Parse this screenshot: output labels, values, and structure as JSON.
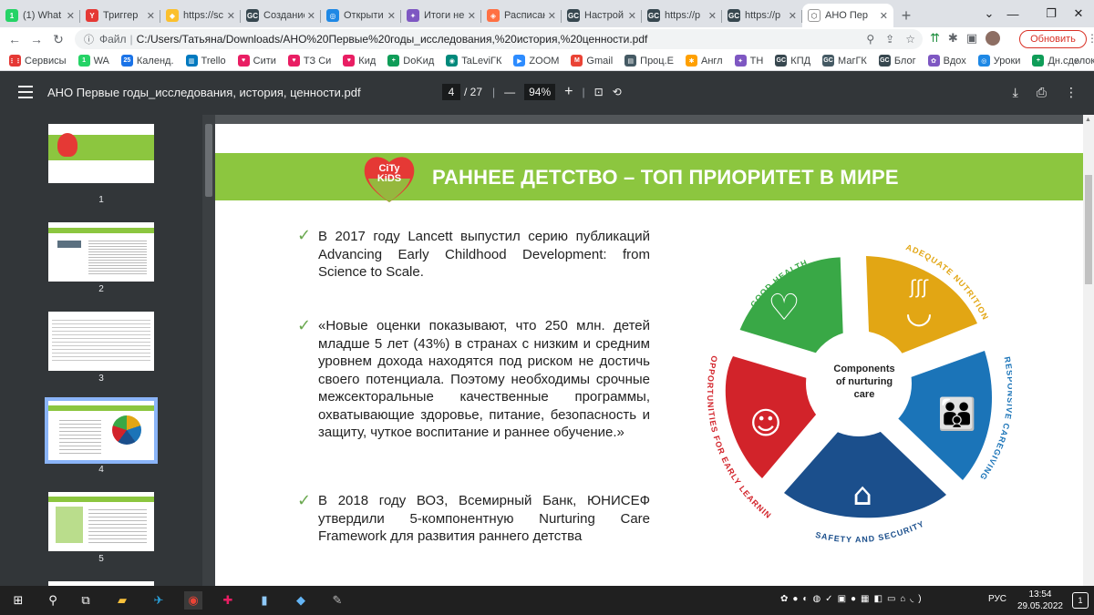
{
  "browser": {
    "tabs": [
      {
        "title": "(1) What",
        "favicon_color": "#25d366",
        "favicon_glyph": "1"
      },
      {
        "title": "Триггер",
        "favicon_color": "#e53935",
        "favicon_glyph": "Y"
      },
      {
        "title": "https://sc",
        "favicon_color": "#fbc02d",
        "favicon_glyph": "◆"
      },
      {
        "title": "Создание",
        "favicon_color": "#37474f",
        "favicon_glyph": "GC"
      },
      {
        "title": "Открыти",
        "favicon_color": "#1e88e5",
        "favicon_glyph": "◎"
      },
      {
        "title": "Итоги не",
        "favicon_color": "#7e57c2",
        "favicon_glyph": "✦"
      },
      {
        "title": "Расписан",
        "favicon_color": "#ff7043",
        "favicon_glyph": "◈"
      },
      {
        "title": "Настрой",
        "favicon_color": "#37474f",
        "favicon_glyph": "GC"
      },
      {
        "title": "https://p",
        "favicon_color": "#37474f",
        "favicon_glyph": "GC"
      },
      {
        "title": "https://p",
        "favicon_color": "#37474f",
        "favicon_glyph": "GC"
      },
      {
        "title": "АНО Пер",
        "favicon_color": "#fff",
        "favicon_glyph": "⬡",
        "active": true
      }
    ],
    "new_tab_label": "+",
    "address": {
      "info_label": "Файл",
      "separator": "|",
      "url": "C:/Users/Татьяна/Downloads/АНО%20Первые%20годы_исследования,%20история,%20ценности.pdf"
    },
    "update_button": "Обновить",
    "bookmarks": [
      {
        "label": "Сервисы",
        "color": "#e53935",
        "glyph": "⋮⋮"
      },
      {
        "label": "WA",
        "color": "#25d366",
        "glyph": "1"
      },
      {
        "label": "Календ.",
        "color": "#1a73e8",
        "glyph": "25"
      },
      {
        "label": "Trello",
        "color": "#0079bf",
        "glyph": "▥"
      },
      {
        "label": "Сити",
        "color": "#e91e63",
        "glyph": "♥"
      },
      {
        "label": "ТЗ Си",
        "color": "#e91e63",
        "glyph": "♥"
      },
      {
        "label": "Кид",
        "color": "#e91e63",
        "glyph": "♥"
      },
      {
        "label": "DoKид",
        "color": "#0f9d58",
        "glyph": "+"
      },
      {
        "label": "TaLeviГК",
        "color": "#00897b",
        "glyph": "◉"
      },
      {
        "label": "ZOOM",
        "color": "#2d8cff",
        "glyph": "▶"
      },
      {
        "label": "Gmail",
        "color": "#ea4335",
        "glyph": "M"
      },
      {
        "label": "Проц.Е",
        "color": "#455a64",
        "glyph": "▤"
      },
      {
        "label": "Англ",
        "color": "#ffa000",
        "glyph": "✱"
      },
      {
        "label": "ТН",
        "color": "#7e57c2",
        "glyph": "✦"
      },
      {
        "label": "КПД",
        "color": "#37474f",
        "glyph": "GC"
      },
      {
        "label": "МагГК",
        "color": "#455a64",
        "glyph": "GC"
      },
      {
        "label": "Блог",
        "color": "#37474f",
        "glyph": "GC"
      },
      {
        "label": "Вдох",
        "color": "#7e57c2",
        "glyph": "✿"
      },
      {
        "label": "Уроки",
        "color": "#1e88e5",
        "glyph": "◎"
      },
      {
        "label": "Дн.сделок",
        "color": "#0f9d58",
        "glyph": "+"
      }
    ],
    "bookmarks_more": "»"
  },
  "pdf": {
    "file_title": "АНО Первые годы_исследования, история, ценности.pdf",
    "current_page": "4",
    "total_pages": "/ 27",
    "zoom_minus": "—",
    "zoom_value": "94%",
    "zoom_plus": "+",
    "thumbnails": [
      {
        "number": "1"
      },
      {
        "number": "2"
      },
      {
        "number": "3"
      },
      {
        "number": "4",
        "selected": true
      },
      {
        "number": "5"
      }
    ]
  },
  "slide": {
    "logo_text_top": "CiTy",
    "logo_text_bottom": "KiDS",
    "title": "РАННЕЕ ДЕТСТВО – ТОП ПРИОРИТЕТ В МИРЕ",
    "bullets": [
      "В 2017 году Lancett выпустил серию публикаций Advancing Early Childhood Development: from Science to Scale.",
      "«Новые оценки показывают, что 250 млн. детей младше 5 лет (43%) в странах с низким и средним уровнем дохода находятся под риском не достичь своего потенциала. Поэтому необходимы срочные межсекторальные качественные программы, охватывающие здоровье, питание, безопасность и защиту, чуткое воспитание и раннее обучение.»",
      "В 2018 году ВОЗ, Всемирный Банк, ЮНИСЕФ утвердили 5-компонентную Nurturing Care Framework для развития раннего детства"
    ],
    "diagram": {
      "center_label_line1": "Components",
      "center_label_line2": "of nurturing",
      "center_label_line3": "care",
      "segments": [
        {
          "label": "GOOD HEALTH",
          "color": "#39a846"
        },
        {
          "label": "ADEQUATE NUTRITION",
          "color": "#e2a614"
        },
        {
          "label": "RESPONSIVE CAREGIVING",
          "color": "#1b74b8"
        },
        {
          "label": "SAFETY AND SECURITY",
          "color": "#1b4f8c"
        },
        {
          "label": "OPPORTUNITIES FOR EARLY LEARNING",
          "color": "#d2232a"
        }
      ]
    }
  },
  "taskbar": {
    "language": "РУС",
    "time": "13:54",
    "date": "29.05.2022",
    "notification_count": "1"
  }
}
